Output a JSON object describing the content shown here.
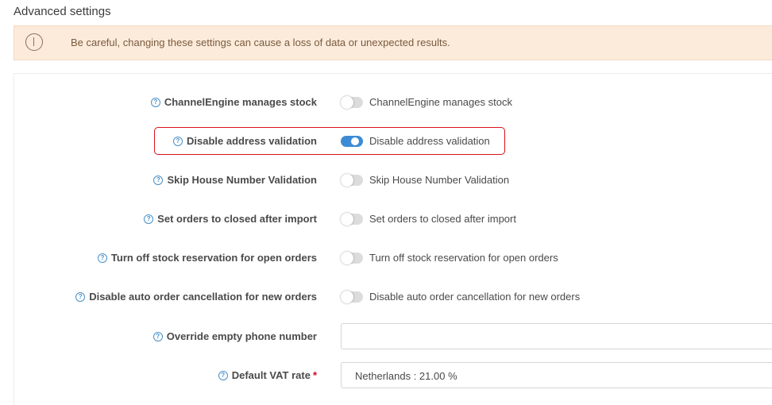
{
  "section_title": "Advanced settings",
  "warning": {
    "text": "Be careful, changing these settings can cause a loss of data or unexpected results."
  },
  "help_glyph": "?",
  "settings": [
    {
      "label": "ChannelEngine manages stock",
      "toggle_label": "ChannelEngine manages stock",
      "enabled": false
    },
    {
      "label": "Disable address validation",
      "toggle_label": "Disable address validation",
      "enabled": true
    },
    {
      "label": "Skip House Number Validation",
      "toggle_label": "Skip House Number Validation",
      "enabled": false
    },
    {
      "label": "Set orders to closed after import",
      "toggle_label": "Set orders to closed after import",
      "enabled": false
    },
    {
      "label": "Turn off stock reservation for open orders",
      "toggle_label": "Turn off stock reservation for open orders",
      "enabled": false
    },
    {
      "label": "Disable auto order cancellation for new orders",
      "toggle_label": "Disable auto order cancellation for new orders",
      "enabled": false
    }
  ],
  "phone": {
    "label": "Override empty phone number",
    "value": ""
  },
  "vat": {
    "label": "Default VAT rate",
    "required_mark": "*",
    "selected": "Netherlands : 21.00 %"
  },
  "colors": {
    "accent": "#3d8bd4",
    "warning_bg": "#fcebdb",
    "highlight": "#d9121e"
  }
}
